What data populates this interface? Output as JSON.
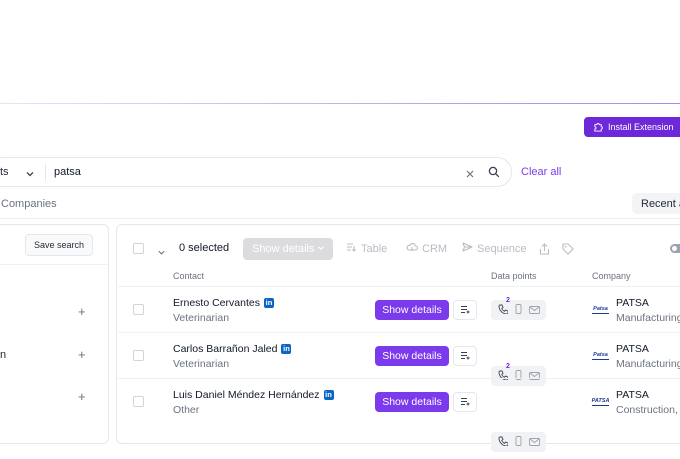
{
  "header": {
    "install_label": "Install Extension"
  },
  "search": {
    "scope_fragment": "ts",
    "query": "patsa",
    "clear_all": "Clear all"
  },
  "tabs": {
    "companies": "Companies",
    "recent": "Recent a"
  },
  "left_panel": {
    "save_search": "Save search",
    "filters": [
      {
        "label": "",
        "plus": "+"
      },
      {
        "label": "n",
        "plus": "+"
      },
      {
        "label": "",
        "plus": "+"
      }
    ]
  },
  "toolbar": {
    "selected": "0 selected",
    "show_details": "Show details",
    "table": "Table",
    "crm": "CRM",
    "sequence": "Sequence"
  },
  "columns": {
    "contact": "Contact",
    "data_points": "Data points",
    "company": "Company"
  },
  "rows": [
    {
      "name": "Ernesto Cervantes",
      "title": "Veterinarian",
      "button": "Show details",
      "phone_count": "2",
      "company": "PATSA",
      "industry": "Manufacturing",
      "logo": "Patsa"
    },
    {
      "name": "Carlos Barrañon Jaled",
      "title": "Veterinarian",
      "button": "Show details",
      "phone_count": "2",
      "company": "PATSA",
      "industry": "Manufacturing",
      "logo": "Patsa"
    },
    {
      "name": "Luis Daniel Méndez Hernández",
      "title": "Other",
      "button": "Show details",
      "phone_count": "",
      "company": "PATSA",
      "industry": "Construction,",
      "logo": "PATSA"
    }
  ],
  "colors": {
    "accent": "#7c3aed",
    "install_button": "#6d28d9",
    "linkedin": "#0a66c2"
  }
}
